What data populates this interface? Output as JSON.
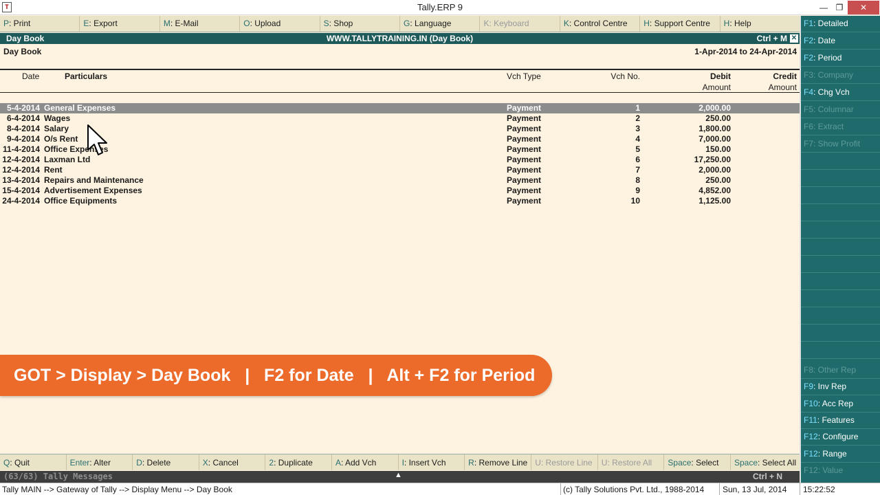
{
  "window": {
    "title": "Tally.ERP 9",
    "minimize": "—",
    "restore": "❐",
    "close": "✕"
  },
  "top_menu": [
    {
      "key": "P",
      "label": ": Print",
      "enabled": true
    },
    {
      "key": "E",
      "label": ": Export",
      "enabled": true
    },
    {
      "key": "M",
      "label": ": E-Mail",
      "enabled": true
    },
    {
      "key": "O",
      "label": ": Upload",
      "enabled": true
    },
    {
      "key": "S",
      "label": ": Shop",
      "enabled": true
    },
    {
      "key": "G",
      "label": ": Language",
      "enabled": true
    },
    {
      "key": "K",
      "label": ": Keyboard",
      "enabled": false
    },
    {
      "key": "K",
      "label": ": Control Centre",
      "enabled": true
    },
    {
      "key": "H",
      "label": ": Support Centre",
      "enabled": true
    },
    {
      "key": "H",
      "label": ": Help",
      "enabled": true
    }
  ],
  "header": {
    "left": "Day Book",
    "center": "WWW.TALLYTRAINING.IN (Day Book)",
    "right": "Ctrl + M",
    "close": "✕"
  },
  "report": {
    "name": "Day Book",
    "period": "1-Apr-2014 to 24-Apr-2014"
  },
  "columns": {
    "date": "Date",
    "particulars": "Particulars",
    "vch_type": "Vch Type",
    "vch_no": "Vch No.",
    "debit": "Debit",
    "debit_sub": "Amount",
    "credit": "Credit",
    "credit_sub": "Amount"
  },
  "rows": [
    {
      "date": "5-4-2014",
      "particulars": "General Expenses",
      "vch_type": "Payment",
      "vch_no": "1",
      "debit": "2,000.00",
      "selected": true
    },
    {
      "date": "6-4-2014",
      "particulars": "Wages",
      "vch_type": "Payment",
      "vch_no": "2",
      "debit": "250.00"
    },
    {
      "date": "8-4-2014",
      "particulars": "Salary",
      "vch_type": "Payment",
      "vch_no": "3",
      "debit": "1,800.00"
    },
    {
      "date": "9-4-2014",
      "particulars": "O/s Rent",
      "vch_type": "Payment",
      "vch_no": "4",
      "debit": "7,000.00"
    },
    {
      "date": "11-4-2014",
      "particulars": "Office Expenses",
      "vch_type": "Payment",
      "vch_no": "5",
      "debit": "150.00"
    },
    {
      "date": "12-4-2014",
      "particulars": "Laxman Ltd",
      "vch_type": "Payment",
      "vch_no": "6",
      "debit": "17,250.00"
    },
    {
      "date": "12-4-2014",
      "particulars": "Rent",
      "vch_type": "Payment",
      "vch_no": "7",
      "debit": "2,000.00"
    },
    {
      "date": "13-4-2014",
      "particulars": "Repairs and Maintenance",
      "vch_type": "Payment",
      "vch_no": "8",
      "debit": "250.00"
    },
    {
      "date": "15-4-2014",
      "particulars": "Advertisement Expenses",
      "vch_type": "Payment",
      "vch_no": "9",
      "debit": "4,852.00"
    },
    {
      "date": "24-4-2014",
      "particulars": "Office Equipments",
      "vch_type": "Payment",
      "vch_no": "10",
      "debit": "1,125.00"
    }
  ],
  "banner": "GOT > Display > Day Book   |   F2 for Date   |   Alt + F2 for Period",
  "bottom_menu": [
    {
      "key": "Q",
      "label": ": Quit",
      "enabled": true
    },
    {
      "key": "Enter",
      "label": ": Alter",
      "enabled": true
    },
    {
      "key": "D",
      "label": ": Delete",
      "enabled": true
    },
    {
      "key": "X",
      "label": ": Cancel",
      "enabled": true
    },
    {
      "key": "2",
      "label": ": Duplicate",
      "enabled": true
    },
    {
      "key": "A",
      "label": ": Add Vch",
      "enabled": true
    },
    {
      "key": "I",
      "label": ": Insert Vch",
      "enabled": true
    },
    {
      "key": "R",
      "label": ": Remove Line",
      "enabled": true
    },
    {
      "key": "U",
      "label": ": Restore Line",
      "enabled": false
    },
    {
      "key": "U",
      "label": ": Restore All",
      "enabled": false
    },
    {
      "key": "Space",
      "label": ": Select",
      "enabled": true
    },
    {
      "key": "Space",
      "label": ": Select All",
      "enabled": true
    }
  ],
  "messages": {
    "text": "(63/63) Tally Messages",
    "caret": "▲",
    "shortcut": "Ctrl + N"
  },
  "status": {
    "path": "Tally MAIN --> Gateway of Tally --> Display Menu --> Day Book",
    "copyright": "(c) Tally Solutions Pvt. Ltd., 1988-2014",
    "date": "Sun, 13 Jul, 2014",
    "time": "15:22:52"
  },
  "sidebar": [
    {
      "key": "F1",
      "label": ": Detailed",
      "enabled": true
    },
    {
      "key": "F2",
      "label": ": Date",
      "enabled": true
    },
    {
      "key": "F2",
      "label": ": Period",
      "enabled": true
    },
    {
      "key": "F3",
      "label": ": Company",
      "enabled": false
    },
    {
      "key": "F4",
      "label": ": Chg Vch",
      "enabled": true
    },
    {
      "key": "F5",
      "label": ": Columnar",
      "enabled": false
    },
    {
      "key": "F6",
      "label": ": Extract",
      "enabled": false
    },
    {
      "key": "F7",
      "label": ": Show Profit",
      "enabled": false
    },
    {
      "key": "F8",
      "label": ": Other Rep",
      "enabled": false
    },
    {
      "key": "F9",
      "label": ": Inv Rep",
      "enabled": true
    },
    {
      "key": "F10",
      "label": ": Acc Rep",
      "enabled": true
    },
    {
      "key": "F11",
      "label": ": Features",
      "enabled": true
    },
    {
      "key": "F12",
      "label": ": Configure",
      "enabled": true
    },
    {
      "key": "F12",
      "label": ": Range",
      "enabled": true
    },
    {
      "key": "F12",
      "label": ": Value",
      "enabled": false
    }
  ]
}
